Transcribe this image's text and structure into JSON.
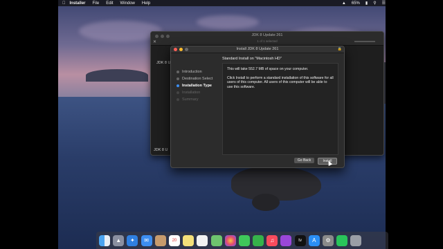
{
  "menubar": {
    "app": "Installer",
    "items": [
      "File",
      "Edit",
      "Window",
      "Help"
    ],
    "battery": "65%",
    "apple_icon": "apple-icon"
  },
  "finder": {
    "title": "JDK 8 Update 261",
    "subtitle": "1 of 1 selected",
    "item_label": "JDK 8 U",
    "bottom_label": "JDK 8 U"
  },
  "installer": {
    "title": "Install JDK 8 Update 261",
    "heading": "Standard Install on \"Macintosh HD\"",
    "steps": [
      {
        "label": "Introduction",
        "state": "done"
      },
      {
        "label": "Destination Select",
        "state": "done"
      },
      {
        "label": "Installation Type",
        "state": "active"
      },
      {
        "label": "Installation",
        "state": "pending"
      },
      {
        "label": "Summary",
        "state": "pending"
      }
    ],
    "body_line1": "This will take 552.7 MB of space on your computer.",
    "body_line2": "Click Install to perform a standard installation of this software for all users of this computer. All users of this computer will be able to use this software.",
    "go_back": "Go Back",
    "install": "Install"
  },
  "dock": {
    "icons": [
      "finder-icon",
      "launchpad-icon",
      "safari-icon",
      "mail-icon",
      "contacts-icon",
      "calendar-icon",
      "notes-icon",
      "reminders-icon",
      "maps-icon",
      "photos-icon",
      "messages-icon",
      "facetime-icon",
      "music-icon",
      "podcasts-icon",
      "tv-icon",
      "app-store-icon",
      "system-preferences-icon",
      "whatsapp-icon",
      "trash-icon"
    ],
    "calendar_day": "20",
    "tv_label": "tv"
  }
}
